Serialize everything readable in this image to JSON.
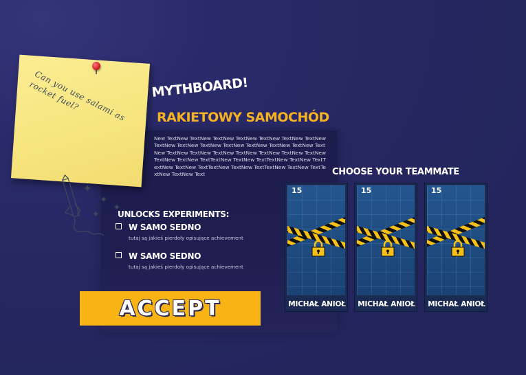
{
  "sticky_note": {
    "text": "Can you use salami as rocket fuel?"
  },
  "header": {
    "title": "MYTHBOARD!",
    "subtitle": "RAKIETOWY SAMOCHÓD"
  },
  "description": "New TextNew TextNew TextNew TextNew TextNew TextNew TextNew TextNew TextNew TextNew TextNew TextNew TextNew TextNew TextNew TextNew TextNew TextNew TextNew TextNew TextNew TextNew TextNew TextNew TextTextNew TextNew TextTextNew TextNew TextTextNew TextNew TextTextNew TextNew TextTextNew TextNew TextTextNew TextNew Text",
  "unlocks": {
    "title": "UNLOCKS EXPERIMENTS:",
    "experiments": [
      {
        "name": "W SAMO SEDNO",
        "description": "tutaj są jakieś pierdoły opisujące achievement",
        "checked": false
      },
      {
        "name": "W SAMO SEDNO",
        "description": "tutaj są jakieś pierdoły opisujące achievement",
        "checked": false
      }
    ]
  },
  "accept_button": {
    "label": "ACCEPT"
  },
  "teammates": {
    "title": "CHOOSE YOUR TEAMMATE",
    "cards": [
      {
        "number": "15",
        "name": "MICHAŁ ANIOŁ",
        "locked": true
      },
      {
        "number": "15",
        "name": "MICHAŁ ANIOŁ",
        "locked": true
      },
      {
        "number": "15",
        "name": "MICHAŁ ANIOŁ",
        "locked": true
      }
    ]
  },
  "colors": {
    "background": "#25265f",
    "accent": "#f5b224",
    "button": "#f8b315",
    "tape_yellow": "#f5c118",
    "card_blue": "#1e4a7e"
  }
}
